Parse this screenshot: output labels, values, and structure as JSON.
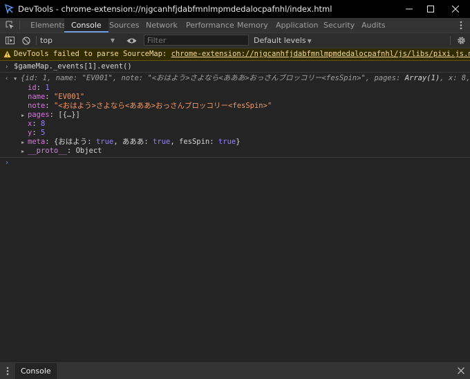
{
  "window": {
    "title": "DevTools - chrome-extension://njgcanhfjdabfmnlmpmdedalocpafnhl/index.html",
    "minimize": "–",
    "maximize": "☐",
    "close": "✕"
  },
  "tabs": [
    {
      "label": "Elements"
    },
    {
      "label": "Console"
    },
    {
      "label": "Sources"
    },
    {
      "label": "Network"
    },
    {
      "label": "Performance"
    },
    {
      "label": "Memory"
    },
    {
      "label": "Application"
    },
    {
      "label": "Security"
    },
    {
      "label": "Audits"
    }
  ],
  "toolbar": {
    "context": "top",
    "filter_placeholder": "Filter",
    "levels": "Default levels"
  },
  "warning": {
    "text": "DevTools failed to parse SourceMap: ",
    "link": "chrome-extension://njgcanhfjdabfmnlmpmdedalocpafnhl/js/libs/pixi.js.map"
  },
  "console": {
    "input": "$gameMap._events[1].event()",
    "summary": {
      "open": "{",
      "id_key": "id",
      "id_val": "1",
      "name_key": "name",
      "name_val": "\"EV001\"",
      "note_key": "note",
      "note_val": "\"<おはよう>さよなら<あああ>おっさんブロッコリー<fesSpin>\"",
      "pages_key": "pages",
      "pages_val": "Array(1)",
      "x_key": "x",
      "x_val": "8",
      "tail": ", …}"
    },
    "props": {
      "id_key": "id",
      "id_val": "1",
      "name_key": "name",
      "name_val": "\"EV001\"",
      "note_key": "note",
      "note_val": "\"<おはよう>さよなら<あああ>おっさんブロッコリー<fesSpin>\"",
      "pages_key": "pages",
      "pages_val": "[{…}]",
      "x_key": "x",
      "x_val": "8",
      "y_key": "y",
      "y_val": "5",
      "meta_key": "meta",
      "meta_open": "{",
      "meta_k1": "おはよう",
      "meta_v1": "true",
      "meta_k2": "あああ",
      "meta_v2": "true",
      "meta_k3": "fesSpin",
      "meta_v3": "true",
      "meta_close": "}",
      "proto_key": "__proto__",
      "proto_val": "Object"
    }
  },
  "drawer": {
    "tab": "Console",
    "close": "✕"
  },
  "colors": {
    "accent": "#6d9cdc",
    "warning_bg": "#332b00",
    "key": "#e36eec",
    "string": "#f29766",
    "number": "#9980ff"
  }
}
